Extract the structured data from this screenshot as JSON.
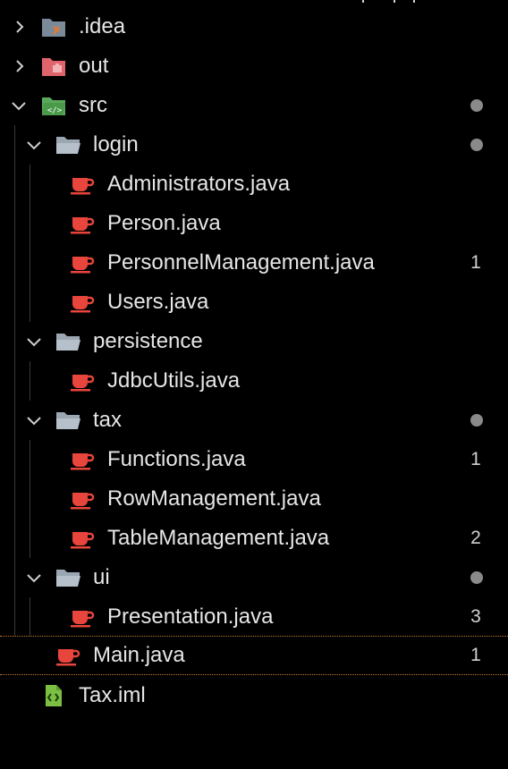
{
  "colors": {
    "background": "#000000",
    "text": "#e6e6e6",
    "java_icon": "#e8453c",
    "folder_icon": "#9aa6b2",
    "src_folder": "#5aa95a",
    "out_folder": "#e0646b",
    "idea_folder": "#7a8a99",
    "iml_icon": "#7bc043",
    "selection_border": "#c7772f",
    "dot": "#8a8a8a"
  },
  "tree": {
    "items": [
      {
        "label": ".idea",
        "icon": "idea-folder-icon",
        "chevron": "chevron-right-icon",
        "badge": "",
        "dot": false
      },
      {
        "label": "out",
        "icon": "out-folder-icon",
        "chevron": "chevron-right-icon",
        "badge": "",
        "dot": false
      },
      {
        "label": "src",
        "icon": "source-folder-icon",
        "chevron": "chevron-down-icon",
        "badge": "",
        "dot": true
      },
      {
        "label": "login",
        "icon": "folder-open-icon",
        "chevron": "chevron-down-icon",
        "badge": "",
        "dot": true
      },
      {
        "label": "Administrators.java",
        "icon": "java-file-icon",
        "badge": "",
        "dot": false
      },
      {
        "label": "Person.java",
        "icon": "java-file-icon",
        "badge": "",
        "dot": false
      },
      {
        "label": "PersonnelManagement.java",
        "icon": "java-file-icon",
        "badge": "1",
        "dot": false
      },
      {
        "label": "Users.java",
        "icon": "java-file-icon",
        "badge": "",
        "dot": false
      },
      {
        "label": "persistence",
        "icon": "folder-open-icon",
        "chevron": "chevron-down-icon",
        "badge": "",
        "dot": false
      },
      {
        "label": "JdbcUtils.java",
        "icon": "java-file-icon",
        "badge": "",
        "dot": false
      },
      {
        "label": "tax",
        "icon": "folder-open-icon",
        "chevron": "chevron-down-icon",
        "badge": "",
        "dot": true
      },
      {
        "label": "Functions.java",
        "icon": "java-file-icon",
        "badge": "1",
        "dot": false
      },
      {
        "label": "RowManagement.java",
        "icon": "java-file-icon",
        "badge": "",
        "dot": false
      },
      {
        "label": "TableManagement.java",
        "icon": "java-file-icon",
        "badge": "2",
        "dot": false
      },
      {
        "label": "ui",
        "icon": "folder-open-icon",
        "chevron": "chevron-down-icon",
        "badge": "",
        "dot": true
      },
      {
        "label": "Presentation.java",
        "icon": "java-file-icon",
        "badge": "3",
        "dot": false
      },
      {
        "label": "Main.java",
        "icon": "java-file-icon",
        "badge": "1",
        "dot": false,
        "selected": true
      },
      {
        "label": "Tax.iml",
        "icon": "iml-file-icon",
        "badge": "",
        "dot": false
      }
    ]
  }
}
